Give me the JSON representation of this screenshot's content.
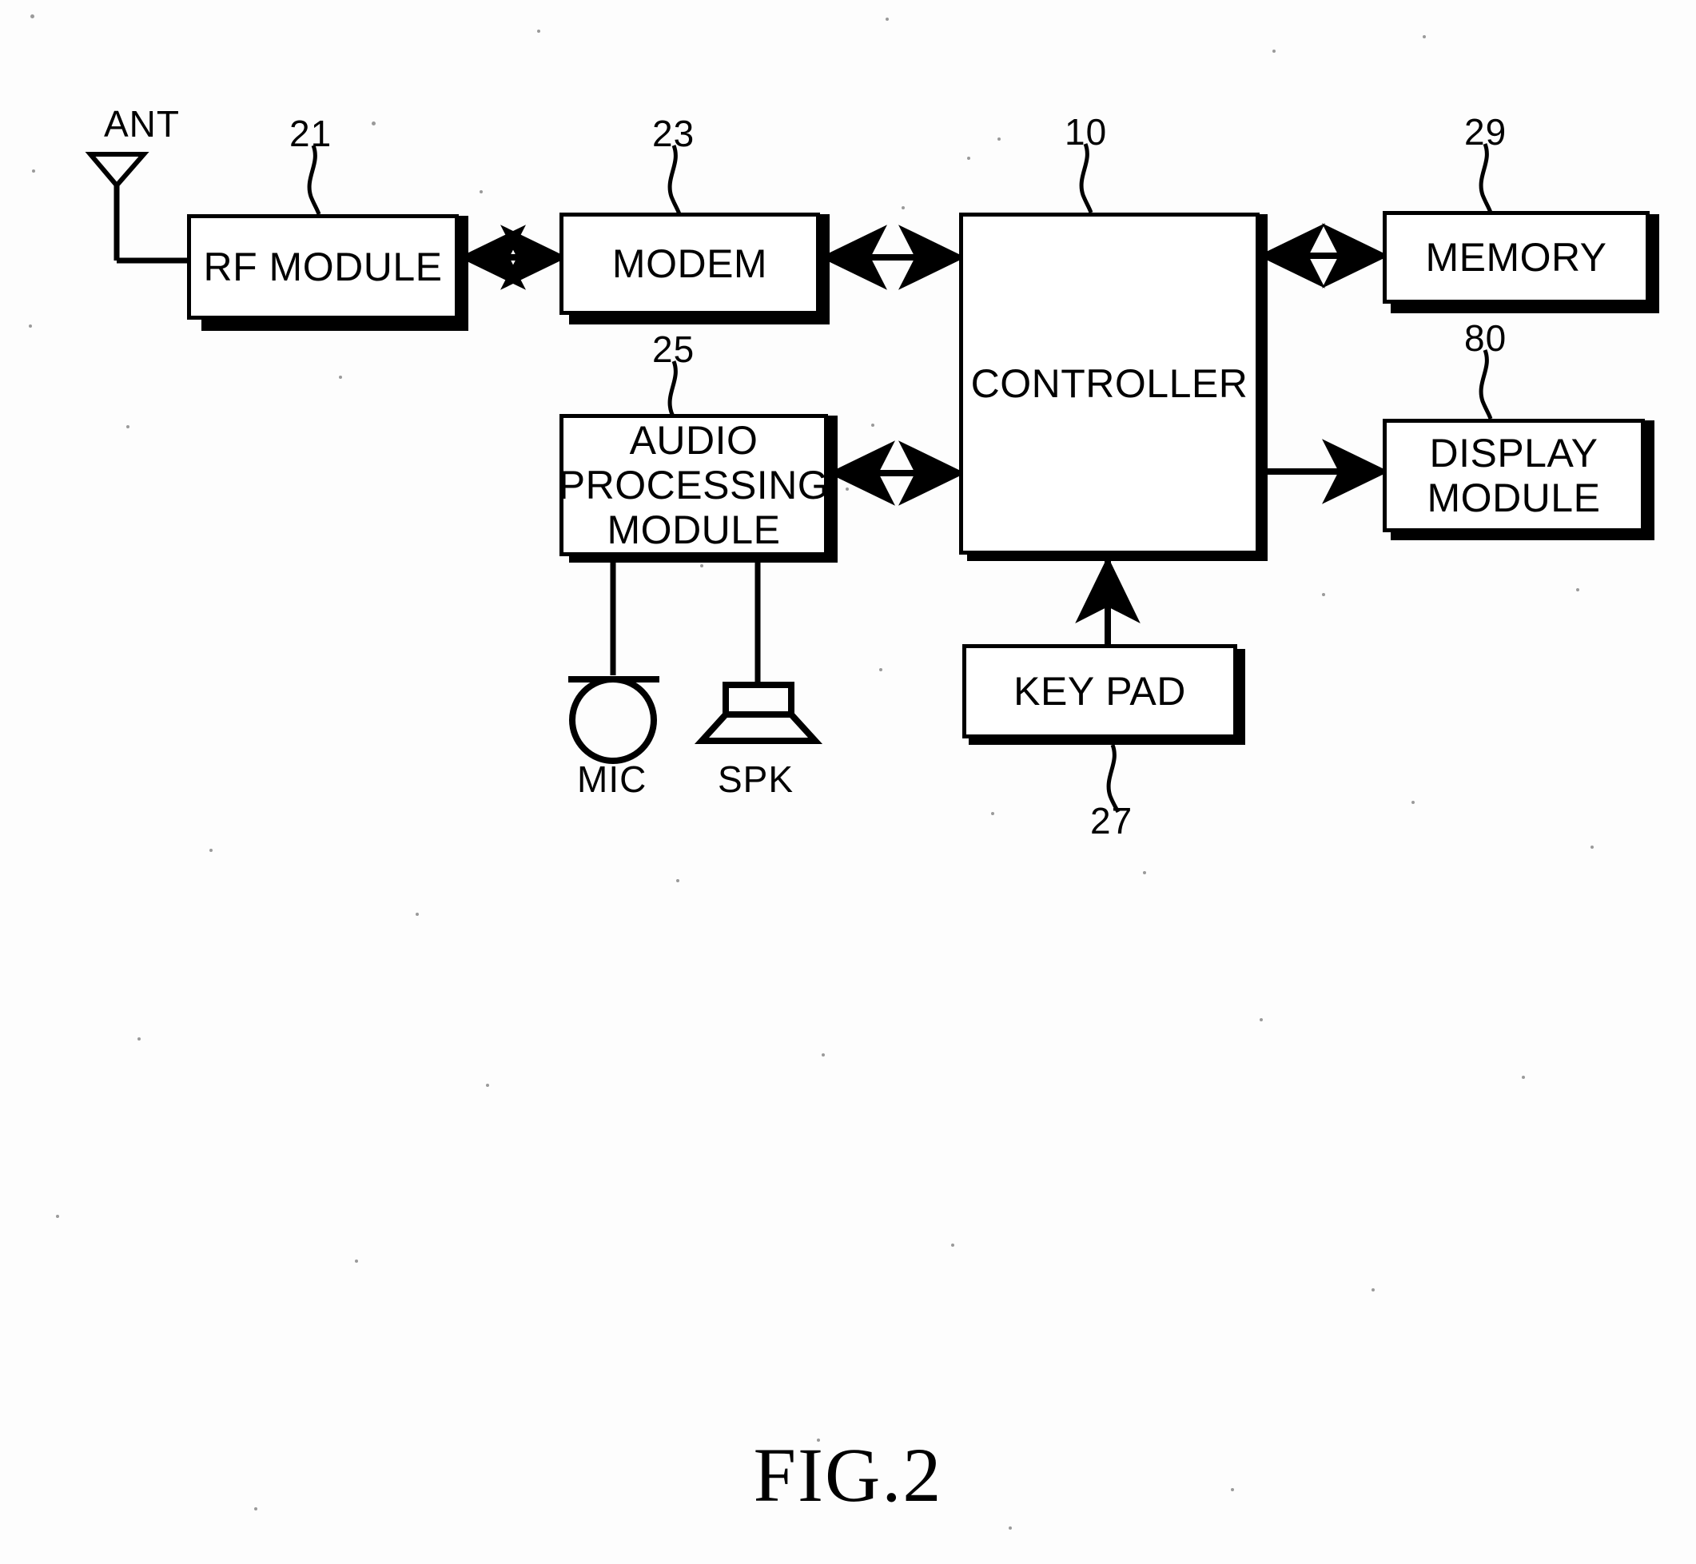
{
  "figure": {
    "caption": "FIG.2",
    "title": "Mobile terminal block diagram"
  },
  "nodes": {
    "rf_module": {
      "label": "RF MODULE",
      "ref": "21"
    },
    "modem": {
      "label": "MODEM",
      "ref": "23"
    },
    "audio_processing_module": {
      "label": "AUDIO\nPROCESSING\nMODULE",
      "ref": "25"
    },
    "controller": {
      "label": "CONTROLLER",
      "ref": "10"
    },
    "memory": {
      "label": "MEMORY",
      "ref": "29"
    },
    "display_module": {
      "label": "DISPLAY\nMODULE",
      "ref": "80"
    },
    "key_pad": {
      "label": "KEY PAD",
      "ref": "27"
    }
  },
  "components": {
    "antenna": {
      "label": "ANT"
    },
    "mic": {
      "label": "MIC"
    },
    "speaker": {
      "label": "SPK"
    }
  },
  "connections": [
    {
      "from": "antenna",
      "to": "rf_module",
      "type": "line"
    },
    {
      "from": "rf_module",
      "to": "modem",
      "type": "bidirectional"
    },
    {
      "from": "modem",
      "to": "controller",
      "type": "bidirectional"
    },
    {
      "from": "audio_processing_module",
      "to": "controller",
      "type": "bidirectional"
    },
    {
      "from": "controller",
      "to": "memory",
      "type": "bidirectional"
    },
    {
      "from": "controller",
      "to": "display_module",
      "type": "unidirectional"
    },
    {
      "from": "key_pad",
      "to": "controller",
      "type": "unidirectional"
    },
    {
      "from": "audio_processing_module",
      "to": "mic",
      "type": "line"
    },
    {
      "from": "audio_processing_module",
      "to": "speaker",
      "type": "line"
    }
  ],
  "colors": {
    "ink": "#000000",
    "paper": "#fdfdfd"
  },
  "chart_data": {
    "type": "diagram",
    "title": "FIG.2",
    "nodes": [
      {
        "id": "ANT",
        "label": "ANT",
        "ref": null
      },
      {
        "id": "21",
        "label": "RF MODULE",
        "ref": "21"
      },
      {
        "id": "23",
        "label": "MODEM",
        "ref": "23"
      },
      {
        "id": "25",
        "label": "AUDIO PROCESSING MODULE",
        "ref": "25"
      },
      {
        "id": "10",
        "label": "CONTROLLER",
        "ref": "10"
      },
      {
        "id": "29",
        "label": "MEMORY",
        "ref": "29"
      },
      {
        "id": "80",
        "label": "DISPLAY MODULE",
        "ref": "80"
      },
      {
        "id": "27",
        "label": "KEY PAD",
        "ref": "27"
      },
      {
        "id": "MIC",
        "label": "MIC",
        "ref": null
      },
      {
        "id": "SPK",
        "label": "SPK",
        "ref": null
      }
    ],
    "edges": [
      {
        "source": "ANT",
        "target": "21",
        "arrow": "none"
      },
      {
        "source": "21",
        "target": "23",
        "arrow": "both"
      },
      {
        "source": "23",
        "target": "10",
        "arrow": "both"
      },
      {
        "source": "25",
        "target": "10",
        "arrow": "both"
      },
      {
        "source": "10",
        "target": "29",
        "arrow": "both"
      },
      {
        "source": "10",
        "target": "80",
        "arrow": "forward"
      },
      {
        "source": "27",
        "target": "10",
        "arrow": "forward"
      },
      {
        "source": "25",
        "target": "MIC",
        "arrow": "none"
      },
      {
        "source": "25",
        "target": "SPK",
        "arrow": "none"
      }
    ]
  }
}
